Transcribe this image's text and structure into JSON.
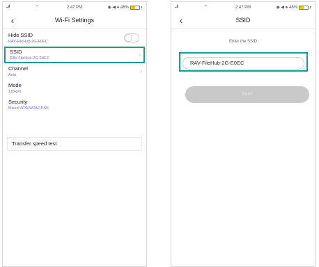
{
  "left": {
    "status": {
      "signal": "..ıl",
      "wifi": "⌔",
      "time": "2:47 PM",
      "right": "◉ ◀ ● 48%",
      "battery_level": 0.48
    },
    "nav": {
      "back": "‹",
      "title": "Wi-Fi Settings"
    },
    "rows": [
      {
        "label": "Hide SSID",
        "value": "RAV-FileHub-2G-E0EC"
      },
      {
        "label": "SSID",
        "value": "RAV-FileHub-2G-E0EC"
      },
      {
        "label": "Channel",
        "value": "Auto"
      },
      {
        "label": "Mode",
        "value": "11b/g/n"
      },
      {
        "label": "Security",
        "value": "Mixed WPA/WPA2-PSK"
      }
    ],
    "speed_test": "Transfer speed test"
  },
  "right": {
    "status": {
      "signal": "..ıl",
      "wifi": "⌔",
      "time": "2:47 PM",
      "right": "◉ ◀ ● 48%",
      "battery_level": 0.48
    },
    "nav": {
      "back": "‹",
      "title": "SSID"
    },
    "prompt": "Enter the SSID",
    "ssid_value": "RAV-FileHub-2G-E0EC",
    "submit_label": "Save"
  },
  "colors": {
    "highlight": "#1a9b8f",
    "value_text": "#7a6ec8",
    "battery": "#f4c20d",
    "button_disabled": "#c9c9c9"
  }
}
